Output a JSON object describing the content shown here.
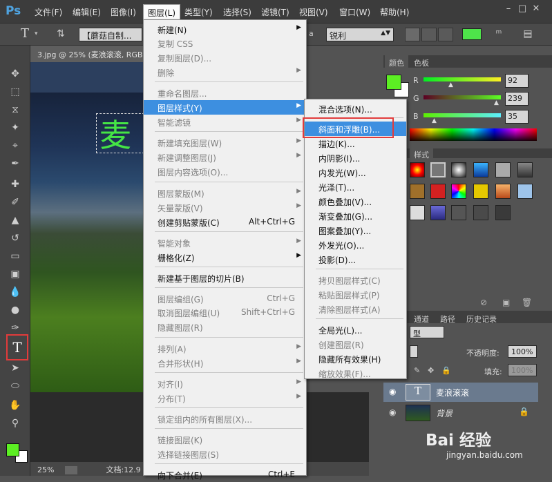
{
  "app": {
    "logo": "Ps"
  },
  "menubar": {
    "items": [
      "文件(F)",
      "编辑(E)",
      "图像(I)",
      "图层(L)",
      "类型(Y)",
      "选择(S)",
      "滤镜(T)",
      "视图(V)",
      "窗口(W)",
      "帮助(H)"
    ],
    "active": "图层(L)"
  },
  "options": {
    "font": "【蘑菇自制...",
    "antialias_prefix": "a",
    "antialias": "锐利",
    "color": "#4ee44a"
  },
  "document": {
    "tab": "3.jpg @ 25% (麦浪滚滚, RGB",
    "text": "麦"
  },
  "status": {
    "zoom": "25%",
    "doc": "文档:12.9"
  },
  "color_panel": {
    "tabs": [
      "颜色",
      "色板"
    ],
    "r": {
      "label": "R",
      "value": "92"
    },
    "g": {
      "label": "G",
      "value": "239"
    },
    "b": {
      "label": "B",
      "value": "35"
    },
    "fg": "#5cef23"
  },
  "style_panel": {
    "tab": "样式"
  },
  "layers_panel": {
    "tabs": [
      "通道",
      "路径",
      "历史记录"
    ],
    "kind": "型",
    "opacity_label": "不透明度:",
    "opacity": "100%",
    "fill_label": "填充:",
    "fill": "100%",
    "layers": [
      {
        "name": "麦浪滚滚",
        "type": "T"
      },
      {
        "name": "背景"
      }
    ]
  },
  "layer_menu": {
    "items": [
      {
        "label": "新建(N)",
        "arrow": true
      },
      {
        "label": "复制 CSS",
        "disabled": true
      },
      {
        "label": "复制图层(D)...",
        "disabled": true
      },
      {
        "label": "删除",
        "disabled": true,
        "arrow": true
      },
      {
        "label": "重命名图层...",
        "disabled": true
      },
      {
        "label": "图层样式(Y)",
        "arrow": true,
        "highlighted": true
      },
      {
        "label": "智能滤镜",
        "disabled": true,
        "arrow": true
      },
      {
        "label": "新建填充图层(W)",
        "disabled": true,
        "arrow": true
      },
      {
        "label": "新建调整图层(J)",
        "disabled": true,
        "arrow": true
      },
      {
        "label": "图层内容选项(O)...",
        "disabled": true
      },
      {
        "label": "图层蒙版(M)",
        "disabled": true,
        "arrow": true
      },
      {
        "label": "矢量蒙版(V)",
        "disabled": true,
        "arrow": true
      },
      {
        "label": "创建剪贴蒙版(C)",
        "shortcut": "Alt+Ctrl+G"
      },
      {
        "label": "智能对象",
        "disabled": true,
        "arrow": true
      },
      {
        "label": "栅格化(Z)",
        "arrow": true
      },
      {
        "label": "新建基于图层的切片(B)"
      },
      {
        "label": "图层编组(G)",
        "disabled": true,
        "shortcut": "Ctrl+G"
      },
      {
        "label": "取消图层编组(U)",
        "disabled": true,
        "shortcut": "Shift+Ctrl+G"
      },
      {
        "label": "隐藏图层(R)",
        "disabled": true
      },
      {
        "label": "排列(A)",
        "disabled": true,
        "arrow": true
      },
      {
        "label": "合并形状(H)",
        "disabled": true,
        "arrow": true
      },
      {
        "label": "对齐(I)",
        "disabled": true,
        "arrow": true
      },
      {
        "label": "分布(T)",
        "disabled": true,
        "arrow": true
      },
      {
        "label": "锁定组内的所有图层(X)...",
        "disabled": true
      },
      {
        "label": "链接图层(K)",
        "disabled": true
      },
      {
        "label": "选择链接图层(S)",
        "disabled": true
      },
      {
        "label": "向下合并(E)",
        "shortcut": "Ctrl+E"
      }
    ]
  },
  "style_submenu": {
    "items": [
      {
        "label": "混合选项(N)..."
      },
      {
        "label": "斜面和浮雕(B)...",
        "highlighted": true
      },
      {
        "label": "描边(K)..."
      },
      {
        "label": "内阴影(I)..."
      },
      {
        "label": "内发光(W)..."
      },
      {
        "label": "光泽(T)..."
      },
      {
        "label": "颜色叠加(V)..."
      },
      {
        "label": "渐变叠加(G)..."
      },
      {
        "label": "图案叠加(Y)..."
      },
      {
        "label": "外发光(O)..."
      },
      {
        "label": "投影(D)..."
      },
      {
        "label": "拷贝图层样式(C)",
        "disabled": true
      },
      {
        "label": "粘贴图层样式(P)",
        "disabled": true
      },
      {
        "label": "清除图层样式(A)",
        "disabled": true
      },
      {
        "label": "全局光(L)..."
      },
      {
        "label": "创建图层(R)",
        "disabled": true
      },
      {
        "label": "隐藏所有效果(H)"
      },
      {
        "label": "缩放效果(F)...",
        "disabled": true
      }
    ]
  },
  "watermark": {
    "brand": "Bai 经验",
    "url": "jingyan.baidu.com"
  }
}
